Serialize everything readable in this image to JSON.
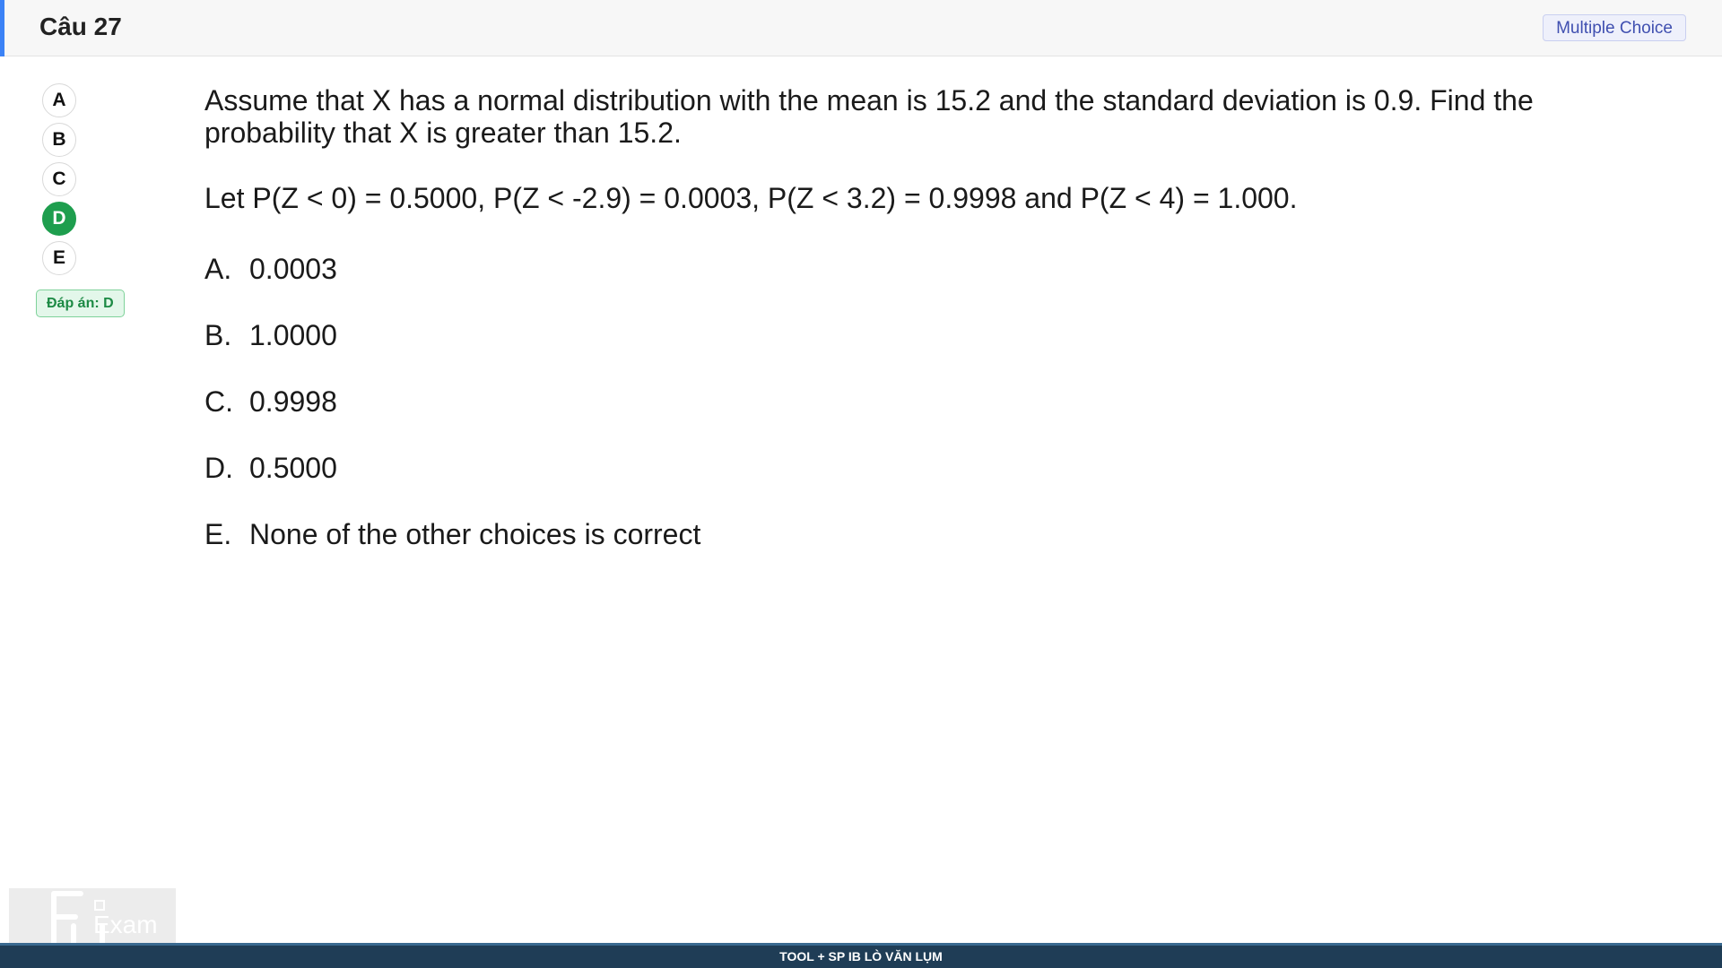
{
  "header": {
    "title": "Câu 27",
    "type_badge": "Multiple Choice",
    "accent_color": "#3b82f6"
  },
  "answer_sidebar": {
    "options": [
      "A",
      "B",
      "C",
      "D",
      "E"
    ],
    "selected": "D",
    "selected_color": "#1e9e4e",
    "answer_label": "Đáp án: D"
  },
  "question": {
    "stem": "Assume that X has a normal distribution with the mean is 15.2 and the standard deviation is 0.9. Find the probability that X is greater than 15.2.",
    "given": "Let P(Z < 0) = 0.5000, P(Z < -2.9) = 0.0003, P(Z < 3.2) = 0.9998 and P(Z < 4) = 1.000."
  },
  "choices": [
    {
      "letter": "A.",
      "text": "0.0003"
    },
    {
      "letter": "B.",
      "text": "1.0000"
    },
    {
      "letter": "C.",
      "text": "0.9998"
    },
    {
      "letter": "D.",
      "text": "0.5000"
    },
    {
      "letter": "E.",
      "text": "None of the other choices is correct"
    }
  ],
  "watermark": {
    "text": "Exam",
    "icon": "fu-exam-logo-icon"
  },
  "footer": {
    "text": "TOOL + SP IB LÒ VĂN LỤM",
    "color": "#1f3d56"
  }
}
